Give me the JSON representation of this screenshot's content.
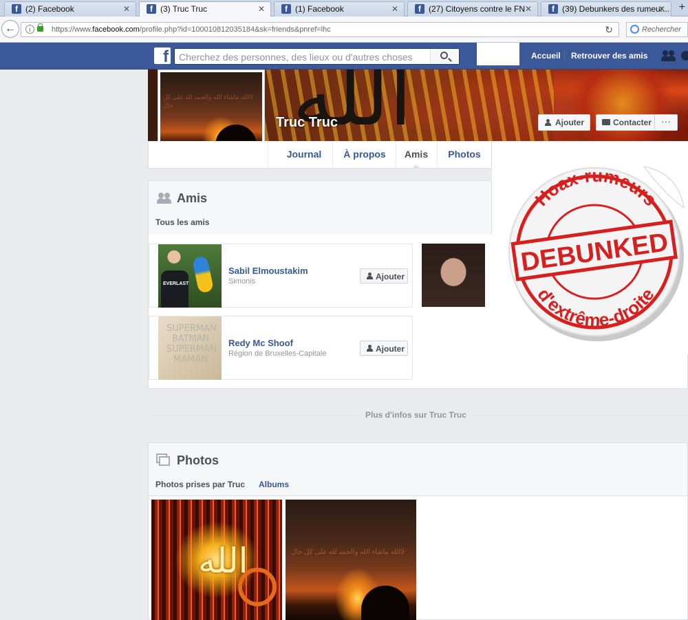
{
  "browser": {
    "tabs": [
      {
        "label": "(2) Facebook"
      },
      {
        "label": "(3) Truc Truc"
      },
      {
        "label": "(1) Facebook"
      },
      {
        "label": "(27) Citoyens contre le FN"
      },
      {
        "label": "(39) Debunkers des rumeur..."
      }
    ],
    "url_prefix": "https://www.",
    "url_domain": "facebook.com",
    "url_path": "/profile.php?id=100010812035184&sk=friends&pnref=lhc",
    "search_placeholder": "Rechercher"
  },
  "facebook": {
    "search_placeholder": "Cherchez des personnes, des lieux ou d'autres choses",
    "nav": {
      "home": "Accueil",
      "find_friends": "Retrouver des amis"
    }
  },
  "profile": {
    "name": "Truc Truc",
    "add_label": "Ajouter",
    "contact_label": "Contacter",
    "more_label": "···",
    "avatar_text": "ﻟﺎﺍﻟﻠﻪ ﻣﺎﺷﺎﺀ ﺍﻟﻠﻪ ﻭﺍﻟﺤﻤﺪ ﻟﻠﻪ ﻋﻠﻰ ﻛﻞ ﺣﺎﻝ"
  },
  "timeline_tabs": [
    {
      "label": "Journal"
    },
    {
      "label": "À propos"
    },
    {
      "label": "Amis"
    },
    {
      "label": "Photos"
    }
  ],
  "friends_card": {
    "title": "Amis",
    "tab": "Tous les amis",
    "friends": [
      {
        "name": "Sabil Elmoustakim",
        "subtitle": "Simonis",
        "button": "Ajouter"
      },
      {
        "name": "Redy Mc Shoof",
        "subtitle": "Région de Bruxelles-Capitale",
        "button": "Ajouter"
      }
    ],
    "shirt_text": "EVERLAST",
    "bag_text": "SUPERMAN BATMAN SUPERMAN MAMAN"
  },
  "stamp": {
    "top_text": "Hoax-rumeurs",
    "center_text": "DEBUNKED",
    "bottom_text": "d'extrême-droite",
    "color": "#d62020"
  },
  "more_info": "Plus d'infos sur Truc Truc",
  "photos_card": {
    "title": "Photos",
    "tab_active": "Photos prises par Truc",
    "tab_albums": "Albums"
  },
  "colors": {
    "fb_blue": "#3b5998",
    "link": "#365899"
  }
}
